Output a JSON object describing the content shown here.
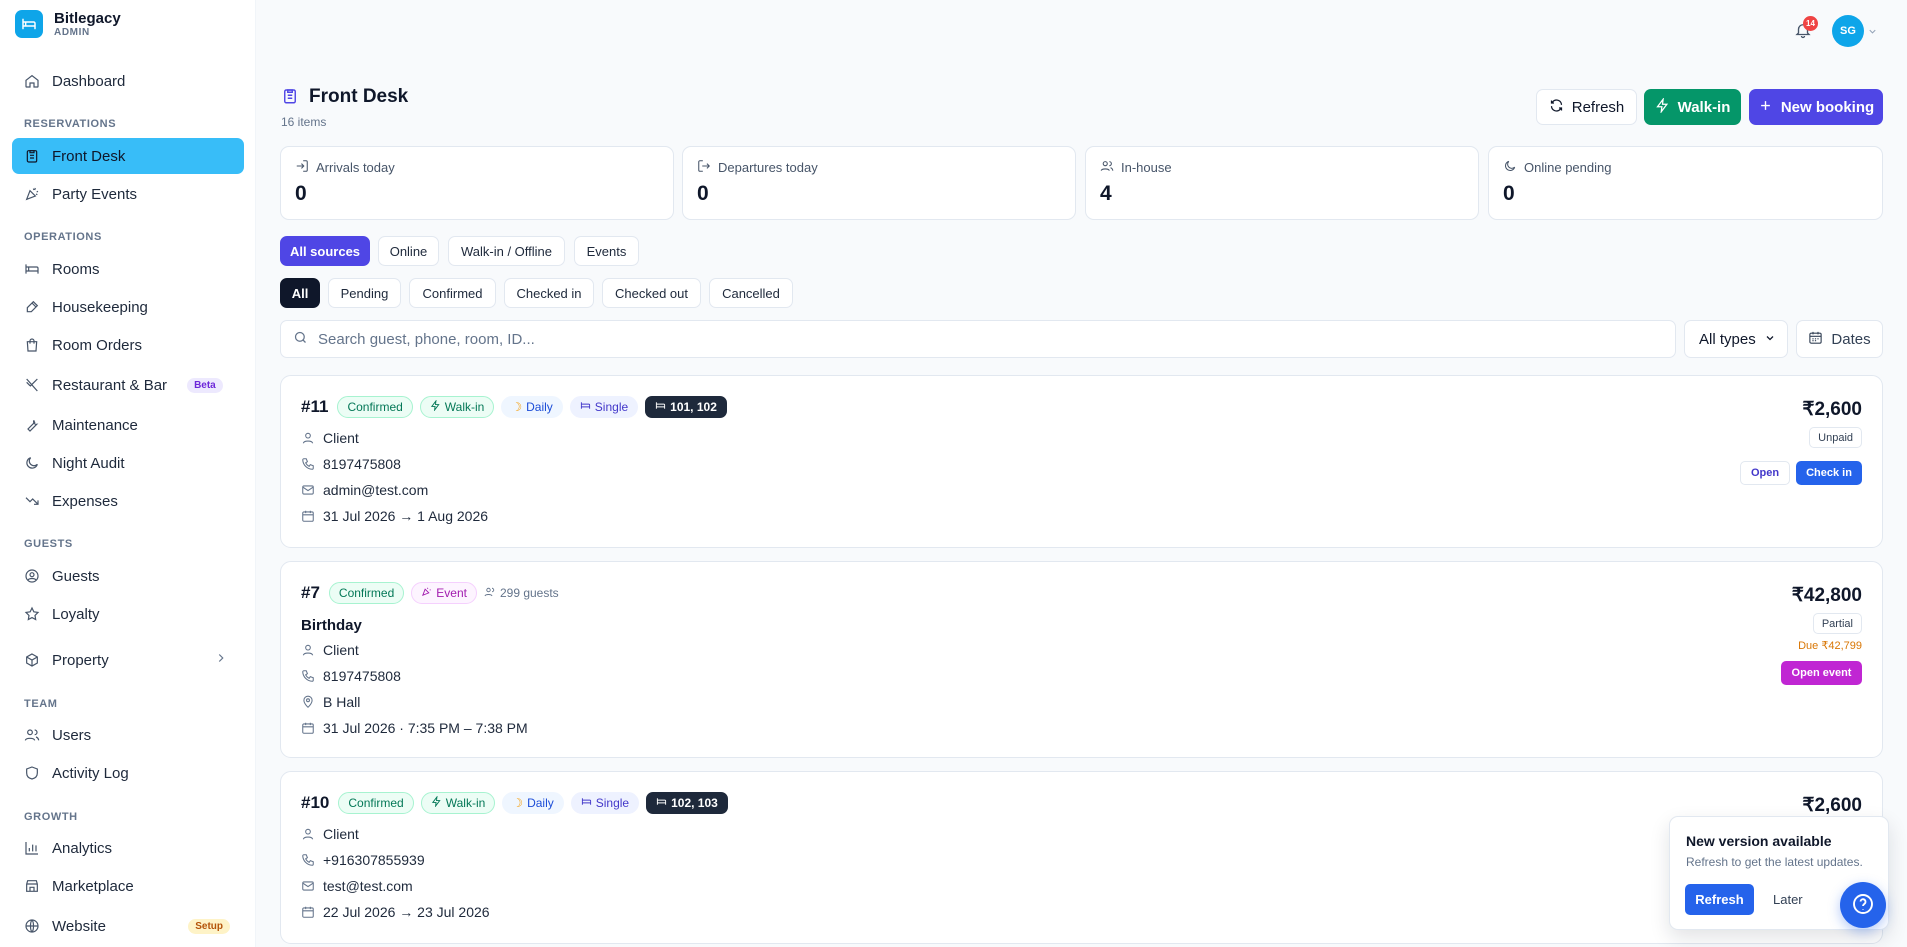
{
  "brand": {
    "name": "Bitlegacy",
    "role": "ADMIN"
  },
  "topbar": {
    "notification_count": "14",
    "avatar_initials": "SG"
  },
  "sidebar": {
    "dashboard": "Dashboard",
    "sections": {
      "reservations": "RESERVATIONS",
      "operations": "OPERATIONS",
      "guests": "GUESTS",
      "team": "TEAM",
      "growth": "GROWTH"
    },
    "items": {
      "front_desk": "Front Desk",
      "party_events": "Party Events",
      "rooms": "Rooms",
      "housekeeping": "Housekeeping",
      "room_orders": "Room Orders",
      "restaurant_bar": "Restaurant & Bar",
      "restaurant_badge": "Beta",
      "maintenance": "Maintenance",
      "night_audit": "Night Audit",
      "expenses": "Expenses",
      "guests": "Guests",
      "loyalty": "Loyalty",
      "property": "Property",
      "users": "Users",
      "activity_log": "Activity Log",
      "analytics": "Analytics",
      "marketplace": "Marketplace",
      "website": "Website",
      "website_badge": "Setup"
    }
  },
  "header": {
    "title": "Front Desk",
    "subtitle": "16 items",
    "refresh": "Refresh",
    "walk_in": "Walk-in",
    "new_booking": "New booking"
  },
  "stats": {
    "arrivals_label": "Arrivals today",
    "arrivals_value": "0",
    "departures_label": "Departures today",
    "departures_value": "0",
    "inhouse_label": "In-house",
    "inhouse_value": "4",
    "online_label": "Online pending",
    "online_value": "0"
  },
  "source_filters": [
    "All sources",
    "Online",
    "Walk-in / Offline",
    "Events"
  ],
  "status_filters": [
    "All",
    "Pending",
    "Confirmed",
    "Checked in",
    "Checked out",
    "Cancelled"
  ],
  "search": {
    "placeholder": "Search guest, phone, room, ID...",
    "type_select": "All types",
    "dates": "Dates"
  },
  "bookings": [
    {
      "id": "#11",
      "status": "Confirmed",
      "source": "Walk-in",
      "plan": "Daily",
      "room_type": "Single",
      "rooms": "101, 102",
      "guest": "Client",
      "phone": "8197475808",
      "email": "admin@test.com",
      "dates": "31 Jul 2026 → 1 Aug 2026",
      "amount": "₹2,600",
      "payment": "Unpaid",
      "open": "Open",
      "action": "Check in"
    },
    {
      "id": "#7",
      "status": "Confirmed",
      "source": "Event",
      "guest_count": "299 guests",
      "event_name": "Birthday",
      "guest": "Client",
      "phone": "8197475808",
      "venue": "B Hall",
      "dates": "31 Jul 2026 · 7:35 PM – 7:38 PM",
      "amount": "₹42,800",
      "payment": "Partial",
      "due": "Due ₹42,799",
      "action": "Open event"
    },
    {
      "id": "#10",
      "status": "Confirmed",
      "source": "Walk-in",
      "plan": "Daily",
      "room_type": "Single",
      "rooms": "102, 103",
      "guest": "Client",
      "phone": "+916307855939",
      "email": "test@test.com",
      "dates": "22 Jul 2026 → 23 Jul 2026",
      "amount": "₹2,600"
    }
  ],
  "toast": {
    "title": "New version available",
    "text": "Refresh to get the latest updates.",
    "refresh": "Refresh",
    "later": "Later"
  },
  "colors": {
    "primary": "#4f46e5",
    "success": "#059669",
    "active_nav": "#38bdf8",
    "event": "#c026d3",
    "action_blue": "#2563eb"
  }
}
